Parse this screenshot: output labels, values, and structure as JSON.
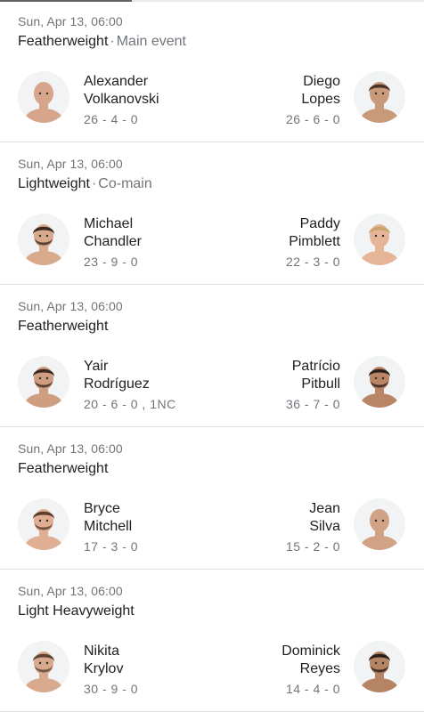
{
  "fights": [
    {
      "date": "Sun, Apr 13, 06:00",
      "weight_class": "Featherweight",
      "tag": "Main event",
      "fighter_left": {
        "first": "Alexander",
        "last": "Volkanovski",
        "record": "26 - 4 - 0"
      },
      "fighter_right": {
        "first": "Diego",
        "last": "Lopes",
        "record": "26 - 6 - 0"
      }
    },
    {
      "date": "Sun, Apr 13, 06:00",
      "weight_class": "Lightweight",
      "tag": "Co-main",
      "fighter_left": {
        "first": "Michael",
        "last": "Chandler",
        "record": "23 - 9 - 0"
      },
      "fighter_right": {
        "first": "Paddy",
        "last": "Pimblett",
        "record": "22 - 3 - 0"
      }
    },
    {
      "date": "Sun, Apr 13, 06:00",
      "weight_class": "Featherweight",
      "tag": "",
      "fighter_left": {
        "first": "Yair",
        "last": "Rodríguez",
        "record": "20 - 6 - 0 , 1NC"
      },
      "fighter_right": {
        "first": "Patrício",
        "last": "Pitbull",
        "record": "36 - 7 - 0"
      }
    },
    {
      "date": "Sun, Apr 13, 06:00",
      "weight_class": "Featherweight",
      "tag": "",
      "fighter_left": {
        "first": "Bryce",
        "last": "Mitchell",
        "record": "17 - 3 - 0"
      },
      "fighter_right": {
        "first": "Jean",
        "last": "Silva",
        "record": "15 - 2 - 0"
      }
    },
    {
      "date": "Sun, Apr 13, 06:00",
      "weight_class": "Light Heavyweight",
      "tag": "",
      "fighter_left": {
        "first": "Nikita",
        "last": "Krylov",
        "record": "30 - 9 - 0"
      },
      "fighter_right": {
        "first": "Dominick",
        "last": "Reyes",
        "record": "14 - 4 - 0"
      }
    }
  ],
  "avatars": {
    "fights.0.fighter_left": {
      "skin": "#d7a58b",
      "hair": "#d7a58b",
      "beard": false
    },
    "fights.0.fighter_right": {
      "skin": "#c99a7a",
      "hair": "#4a3426",
      "beard": false
    },
    "fights.1.fighter_left": {
      "skin": "#d9a98c",
      "hair": "#3b2a20",
      "beard": true
    },
    "fights.1.fighter_right": {
      "skin": "#e6b497",
      "hair": "#c9a36a",
      "beard": false
    },
    "fights.2.fighter_left": {
      "skin": "#cf9d80",
      "hair": "#3a2a20",
      "beard": true
    },
    "fights.2.fighter_right": {
      "skin": "#b98566",
      "hair": "#2c201a",
      "beard": true
    },
    "fights.3.fighter_left": {
      "skin": "#dfae93",
      "hair": "#5a3d2a",
      "beard": true
    },
    "fights.3.fighter_right": {
      "skin": "#d2a286",
      "hair": "#d2a286",
      "beard": false
    },
    "fights.4.fighter_left": {
      "skin": "#d8a98d",
      "hair": "#5b4433",
      "beard": true
    },
    "fights.4.fighter_right": {
      "skin": "#b58464",
      "hair": "#2a1f18",
      "beard": true
    }
  }
}
